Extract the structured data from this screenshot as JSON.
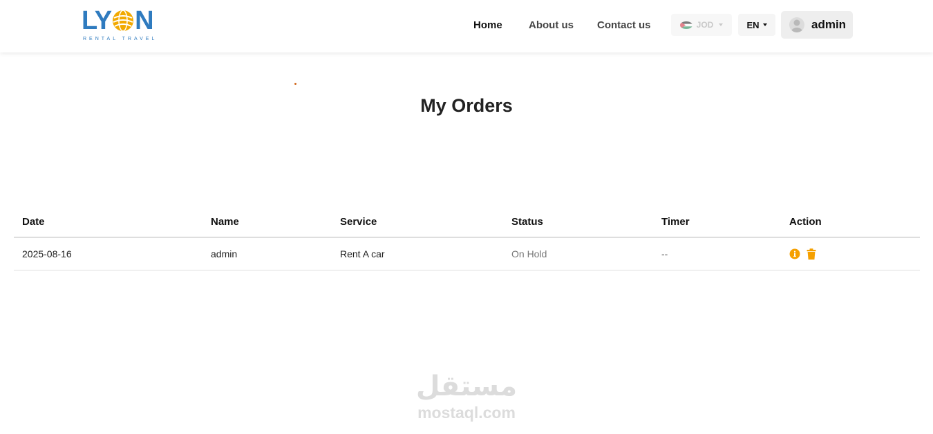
{
  "brand": {
    "logo_text_left": "LY",
    "logo_text_right": "N",
    "tagline": "RENTAL TRAVEL",
    "primary_color": "#2f7bbf",
    "globe_color": "#f2a900"
  },
  "nav": {
    "home": "Home",
    "about": "About us",
    "contact": "Contact us"
  },
  "currency": {
    "selected": "JOD",
    "icon": "jordan-flag-icon"
  },
  "language": {
    "selected": "EN"
  },
  "user": {
    "name": "admin",
    "avatar_icon": "user-avatar-icon"
  },
  "page": {
    "title": "My Orders"
  },
  "orders": {
    "columns": [
      "Date",
      "Name",
      "Service",
      "Status",
      "Timer",
      "Action"
    ],
    "rows": [
      {
        "date": "2025-08-16",
        "name": "admin",
        "service": "Rent A car",
        "status": "On Hold",
        "timer": "--",
        "actions": [
          "info-icon",
          "trash-icon"
        ]
      }
    ],
    "action_color": "#f5a000"
  },
  "watermark": {
    "arabic": "مستقل",
    "latin": "mostaql.com"
  }
}
